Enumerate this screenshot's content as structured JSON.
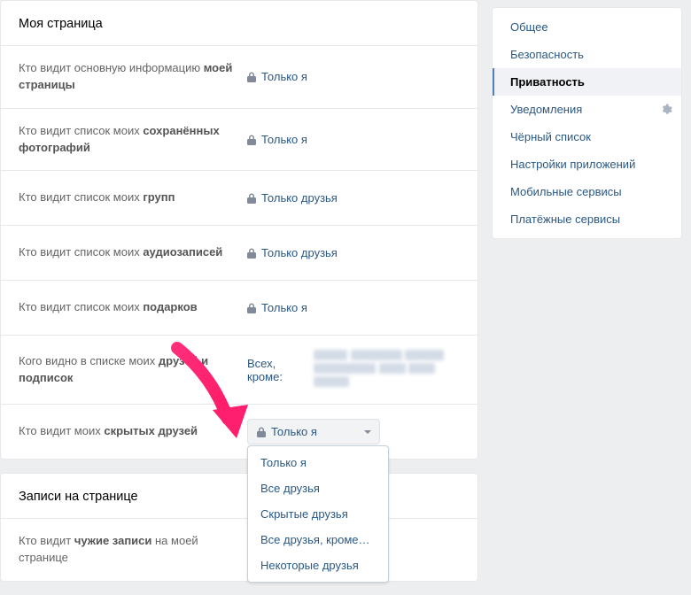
{
  "sections": {
    "my_page": {
      "title": "Моя страница",
      "rows": [
        {
          "label_pre": "Кто видит основную информацию ",
          "label_bold": "моей страницы",
          "value": "Только я",
          "locked": true
        },
        {
          "label_pre": "Кто видит список моих ",
          "label_bold": "сохранённых фотографий",
          "value": "Только я",
          "locked": true
        },
        {
          "label_pre": "Кто видит список моих ",
          "label_bold": "групп",
          "value": "Только друзья",
          "locked": true
        },
        {
          "label_pre": "Кто видит список моих ",
          "label_bold": "аудиозаписей",
          "value": "Только друзья",
          "locked": true
        },
        {
          "label_pre": "Кто видит список моих ",
          "label_bold": "подарков",
          "value": "Только я",
          "locked": true
        },
        {
          "label_pre": "Кого видно в списке моих ",
          "label_bold": "друзей и подписок",
          "value_prefix": "Всех, кроме: ",
          "redacted": true
        },
        {
          "label_pre": "Кто видит моих ",
          "label_bold": "скрытых друзей",
          "dropdown_selected": "Только я",
          "dropdown_options": [
            "Только я",
            "Все друзья",
            "Скрытые друзья",
            "Все друзья, кроме…",
            "Некоторые друзья"
          ]
        }
      ]
    },
    "wall": {
      "title": "Записи на странице",
      "rows": [
        {
          "label_pre": "Кто видит ",
          "label_bold": "чужие записи",
          "label_post": " на моей странице"
        }
      ]
    }
  },
  "sidebar": {
    "items": [
      {
        "label": "Общее"
      },
      {
        "label": "Безопасность"
      },
      {
        "label": "Приватность",
        "active": true
      },
      {
        "label": "Уведомления",
        "gear": true
      },
      {
        "label": "Чёрный список"
      },
      {
        "label": "Настройки приложений"
      },
      {
        "label": "Мобильные сервисы"
      },
      {
        "label": "Платёжные сервисы"
      }
    ]
  }
}
